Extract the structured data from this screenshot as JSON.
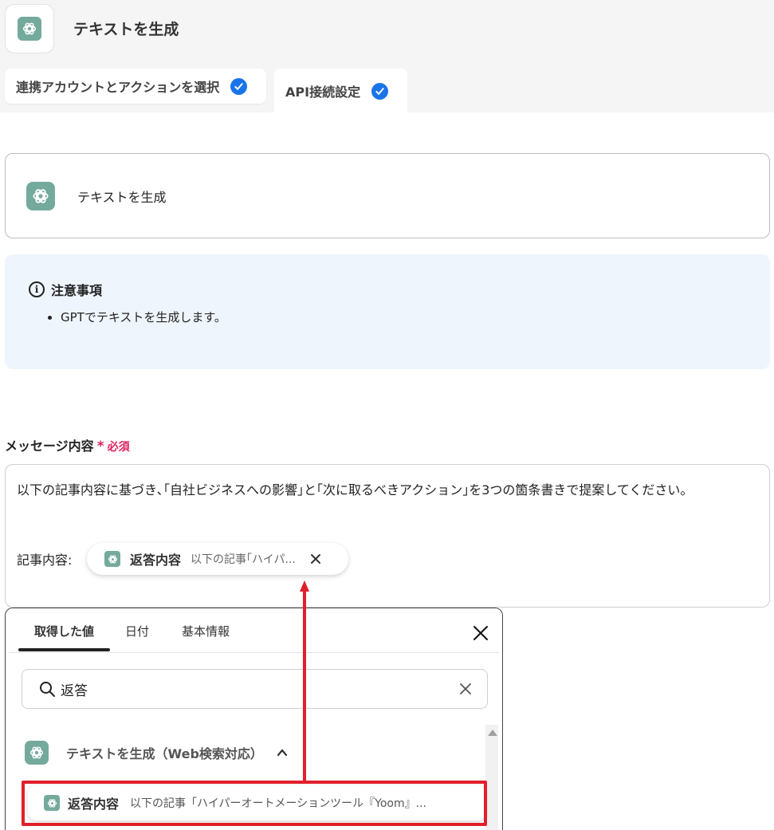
{
  "header": {
    "title": "テキストを生成",
    "app_icon": "openai-logo"
  },
  "tabs": [
    {
      "label": "連携アカウントとアクションを選択",
      "completed": true
    },
    {
      "label": "API接続設定",
      "completed": true
    }
  ],
  "action_card": {
    "label": "テキストを生成"
  },
  "notice": {
    "title": "注意事項",
    "items": [
      "GPTでテキストを生成します。"
    ]
  },
  "message_field": {
    "label": "メッセージ内容",
    "required_mark": "*",
    "required_text": "必須",
    "text_line": "以下の記事内容に基づき､｢自社ビジネスへの影響｣と｢次に取るべきアクション｣を3つの箇条書きで提案してください。",
    "article_label": "記事内容:",
    "chip": {
      "title": "返答内容",
      "preview": "以下の記事｢ハイパ..."
    }
  },
  "popup": {
    "tabs": [
      "取得した値",
      "日付",
      "基本情報"
    ],
    "active_tab": 0,
    "search": {
      "value": "返答",
      "placeholder": ""
    },
    "group": {
      "title": "テキストを生成（Web検索対応）",
      "expanded": true
    },
    "result": {
      "title": "返答内容",
      "preview": "以下の記事「ハイパーオートメーションツール『Yoom』..."
    }
  },
  "colors": {
    "accent_blue": "#1a73e8",
    "openai_green": "#74aa9c",
    "required_red": "#e0245e",
    "annotation_red": "#e0202a",
    "notice_bg": "#eef5fd"
  }
}
